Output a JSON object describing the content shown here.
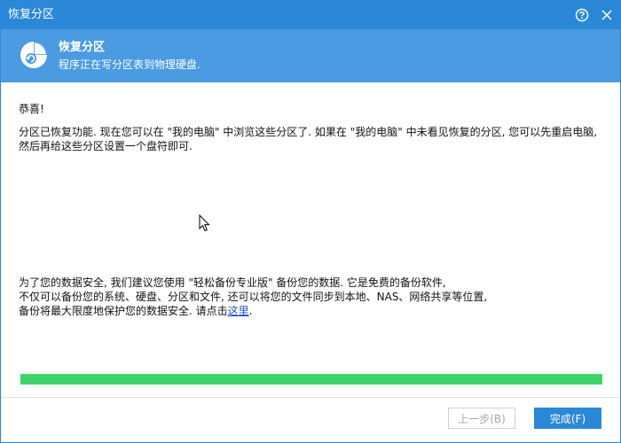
{
  "window": {
    "title": "恢复分区",
    "help_icon": "question-circle-icon",
    "close_icon": "close-icon",
    "accent": "#2b88d8"
  },
  "header": {
    "icon": "partition-restore-icon",
    "title": "恢复分区",
    "subtitle": "程序正在写分区表到物理硬盘."
  },
  "content": {
    "greeting": "恭喜!",
    "message": "分区已恢复功能. 现在您可以在 \"我的电脑\" 中浏览这些分区了. 如果在 \"我的电脑\" 中未看见恢复的分区, 您可以先重启电脑, 然后再给这些分区设置一个盘符即可.",
    "promo_line1": "为了您的数据安全, 我们建议您使用 \"轻松备份专业版\" 备份您的数据. 它是免费的备份软件,",
    "promo_line2": "不仅可以备份您的系统、硬盘、分区和文件, 还可以将您的文件同步到本地、NAS、网络共享等位置,",
    "promo_line3_prefix": "备份将最大限度地保护您的数据安全. 请点击",
    "promo_link": "这里",
    "promo_line3_suffix": "."
  },
  "progress": {
    "percent": 100,
    "color": "#3fd46a"
  },
  "buttons": {
    "prev_label": "上一步(B)",
    "finish_label": "完成(F)"
  }
}
